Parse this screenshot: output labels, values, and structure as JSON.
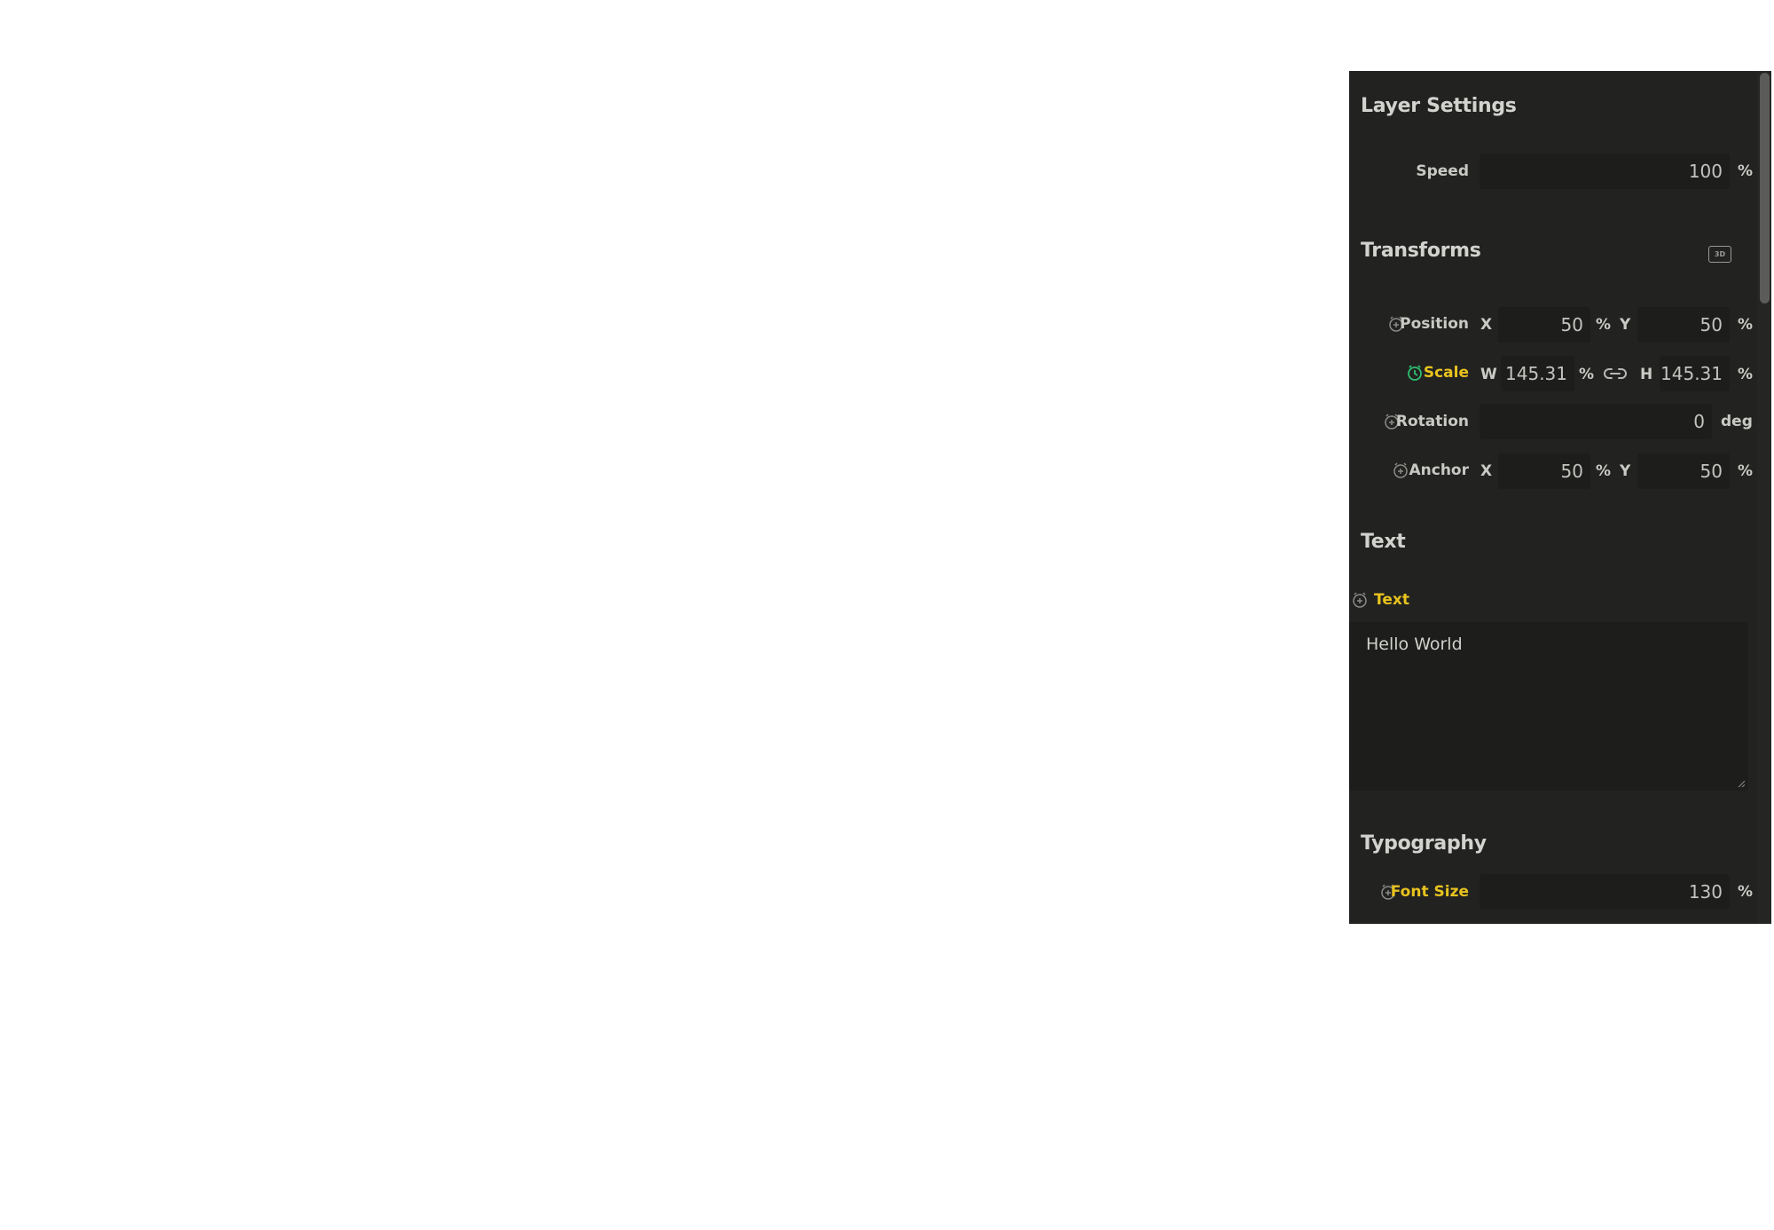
{
  "layer_settings": {
    "title": "Layer Settings",
    "speed": {
      "label": "Speed",
      "value": "100",
      "unit": "%"
    }
  },
  "transforms": {
    "title": "Transforms",
    "toggle_3d_label": "3D",
    "position": {
      "label": "Position",
      "x_axis": "X",
      "x_value": "50",
      "x_unit": "%",
      "y_axis": "Y",
      "y_value": "50",
      "y_unit": "%"
    },
    "scale": {
      "label": "Scale",
      "w_axis": "W",
      "w_value": "145.31",
      "w_unit": "%",
      "h_axis": "H",
      "h_value": "145.31",
      "h_unit": "%"
    },
    "rotation": {
      "label": "Rotation",
      "value": "0",
      "unit": "deg"
    },
    "anchor": {
      "label": "Anchor",
      "x_axis": "X",
      "x_value": "50",
      "x_unit": "%",
      "y_axis": "Y",
      "y_value": "50",
      "y_unit": "%"
    }
  },
  "text_section": {
    "title": "Text",
    "label": "Text",
    "value": "Hello World"
  },
  "typography": {
    "title": "Typography",
    "font_size": {
      "label": "Font Size",
      "value": "130",
      "unit": "%"
    }
  },
  "colors": {
    "panel_bg": "#222221",
    "field_bg": "#1d1e1c",
    "active_label": "#e8c31e",
    "keyframe_active": "#2fbf71"
  }
}
